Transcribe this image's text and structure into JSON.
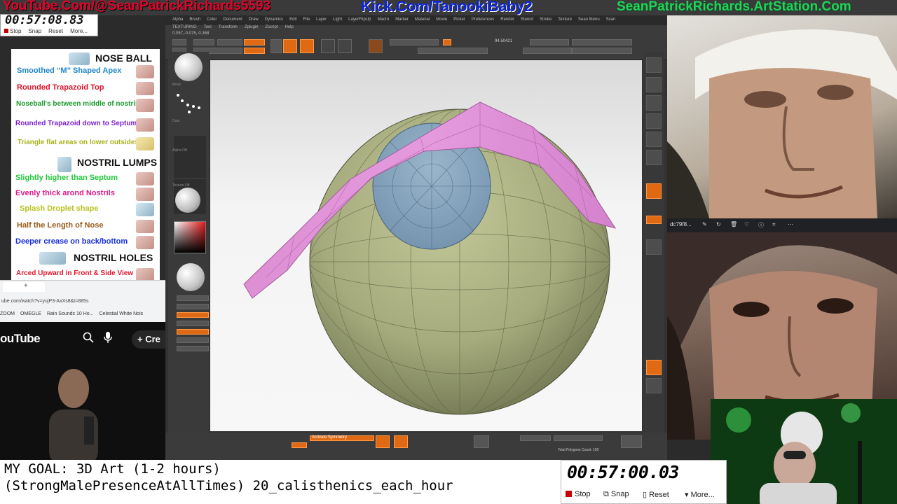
{
  "banner": {
    "youtube": "YouTube.Com/@SeanPatrickRichards5593",
    "kick": "Kick.Com/TanookiBaby2",
    "artstation": "SeanPatrickRichards.ArtStation.Com"
  },
  "stopwatch_small": {
    "time": "00:57:08.83",
    "stop": "Stop",
    "snap": "Snap",
    "reset": "Reset",
    "more": "More..."
  },
  "reference_sheet": {
    "headers": {
      "nose_ball": "NOSE BALL",
      "nostril_lumps": "NOSTRIL LUMPS",
      "nostril_holes": "NOSTRIL HOLES"
    },
    "items": [
      {
        "label": "Smoothed “M” Shaped Apex",
        "color": "#1f86c9"
      },
      {
        "label": "Rounded Trapazoid Top",
        "color": "#e0152b"
      },
      {
        "label": "Noseball's between middle of nostrils",
        "color": "#1c9a2e"
      },
      {
        "label": "Rounded Trapazoid down to Septum",
        "color": "#7a1fd0"
      },
      {
        "label": "Triangle flat areas on lower outsides",
        "color": "#a8b21a"
      },
      {
        "label": "Slightly higher than Septum",
        "color": "#21c63a"
      },
      {
        "label": "Evenly thick arond Nostrils",
        "color": "#e01a8a"
      },
      {
        "label": "Splash Droplet shape",
        "color": "#b7c21e"
      },
      {
        "label": "Half the Length of Nose",
        "color": "#9a5a18"
      },
      {
        "label": "Deeper crease on back/bottom",
        "color": "#1a2ee0"
      },
      {
        "label": "Arced Upward in Front & Side View",
        "color": "#e0152b"
      }
    ]
  },
  "browser": {
    "url": "ube.com/watch?v=yujP3-AxXs8&t=885s",
    "bookmarks": [
      "ZOOM",
      "OMEGLE",
      "Rain Sounds 10 Ho...",
      "Celestial White Nois"
    ]
  },
  "youtube": {
    "logo": "ouTube",
    "create": "Cre"
  },
  "zbrush": {
    "menu": [
      "Alpha",
      "Brush",
      "Color",
      "Document",
      "Draw",
      "Dynamics",
      "Edit",
      "File",
      "Layer",
      "Light",
      "LayerFlipUp",
      "Macro",
      "Marker",
      "Material",
      "Movie",
      "Picker",
      "Preferences",
      "Render",
      "Stencil",
      "Stroke",
      "Texture",
      "Sean Menu",
      "Scan",
      "Texture"
    ],
    "submenu": [
      "TEXTURING",
      "Tool",
      "Transform",
      "Zplugin",
      "Zscript",
      "Help"
    ],
    "coords": "0.057,-0.075,-0.368",
    "value": "94.50421",
    "bottom_symmetry": "Activate Symmetry",
    "polycount": "Total Polygons Count: 100"
  },
  "goal": {
    "line1": "MY GOAL: 3D Art (1-2 hours)",
    "line2": "(StrongMalePresenceAtAllTimes) 20_calisthenics_each_hour"
  },
  "stopwatch_big": {
    "time": "00:57:00.03",
    "stop": "Stop",
    "snap": "Snap",
    "reset": "Reset",
    "more": "More..."
  },
  "icons": [
    "search-icon",
    "mic-icon",
    "plus-icon",
    "stop-icon",
    "snap-icon",
    "reset-icon",
    "more-icon"
  ],
  "colors": {
    "zbrush_orange": "#e06a14",
    "eyeball_green": "#9ea676",
    "iris_blue": "#7f9fba",
    "eyelid_pink": "#e38fd8"
  }
}
